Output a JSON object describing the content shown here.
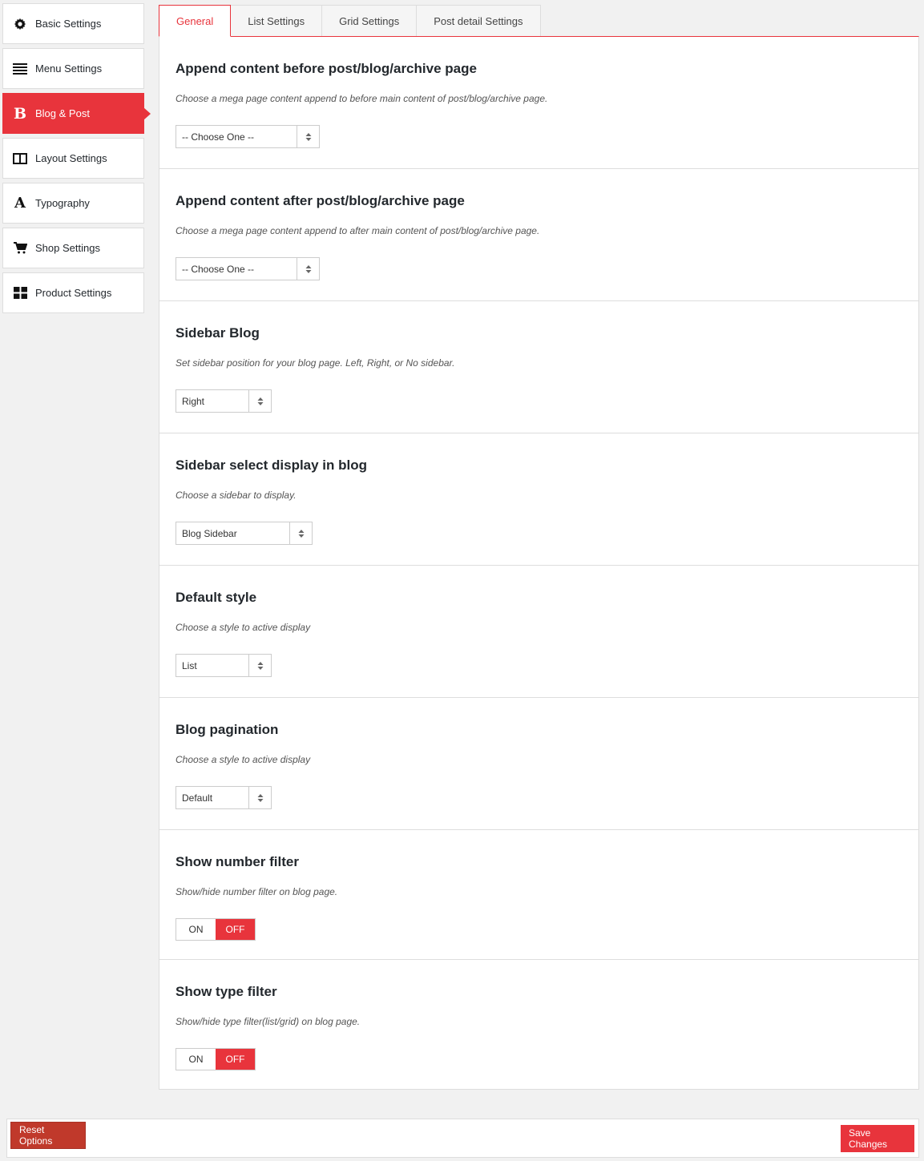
{
  "sidebar": {
    "items": [
      {
        "label": "Basic Settings",
        "icon": "gear-icon"
      },
      {
        "label": "Menu Settings",
        "icon": "menu-lines-icon"
      },
      {
        "label": "Blog & Post",
        "icon": "bold-b-icon",
        "active": true
      },
      {
        "label": "Layout Settings",
        "icon": "columns-icon"
      },
      {
        "label": "Typography",
        "icon": "letter-a-icon"
      },
      {
        "label": "Shop Settings",
        "icon": "cart-icon"
      },
      {
        "label": "Product Settings",
        "icon": "grid-icon"
      }
    ]
  },
  "tabs": [
    {
      "label": "General",
      "active": true
    },
    {
      "label": "List Settings"
    },
    {
      "label": "Grid Settings"
    },
    {
      "label": "Post detail Settings"
    }
  ],
  "sections": [
    {
      "title": "Append content before post/blog/archive page",
      "desc": "Choose a mega page content append to before main content of post/blog/archive page.",
      "value": "-- Choose One --"
    },
    {
      "title": "Append content after post/blog/archive page",
      "desc": "Choose a mega page content append to after main content of post/blog/archive page.",
      "value": "-- Choose One --"
    },
    {
      "title": "Sidebar Blog",
      "desc": "Set sidebar position for your blog page. Left, Right, or No sidebar.",
      "value": "Right"
    },
    {
      "title": "Sidebar select display in blog",
      "desc": "Choose a sidebar to display.",
      "value": "Blog Sidebar"
    },
    {
      "title": "Default style",
      "desc": "Choose a style to active display",
      "value": "List"
    },
    {
      "title": "Blog pagination",
      "desc": "Choose a style to active display",
      "value": "Default"
    },
    {
      "title": "Show number filter",
      "desc": "Show/hide number filter on blog page.",
      "on_label": "ON",
      "off_label": "OFF"
    },
    {
      "title": "Show type filter",
      "desc": "Show/hide type filter(list/grid) on blog page.",
      "on_label": "ON",
      "off_label": "OFF"
    }
  ],
  "footer": {
    "reset_label": "Reset Options",
    "save_label": "Save Changes"
  },
  "colors": {
    "accent": "#e8343c",
    "reset": "#c0392b"
  }
}
